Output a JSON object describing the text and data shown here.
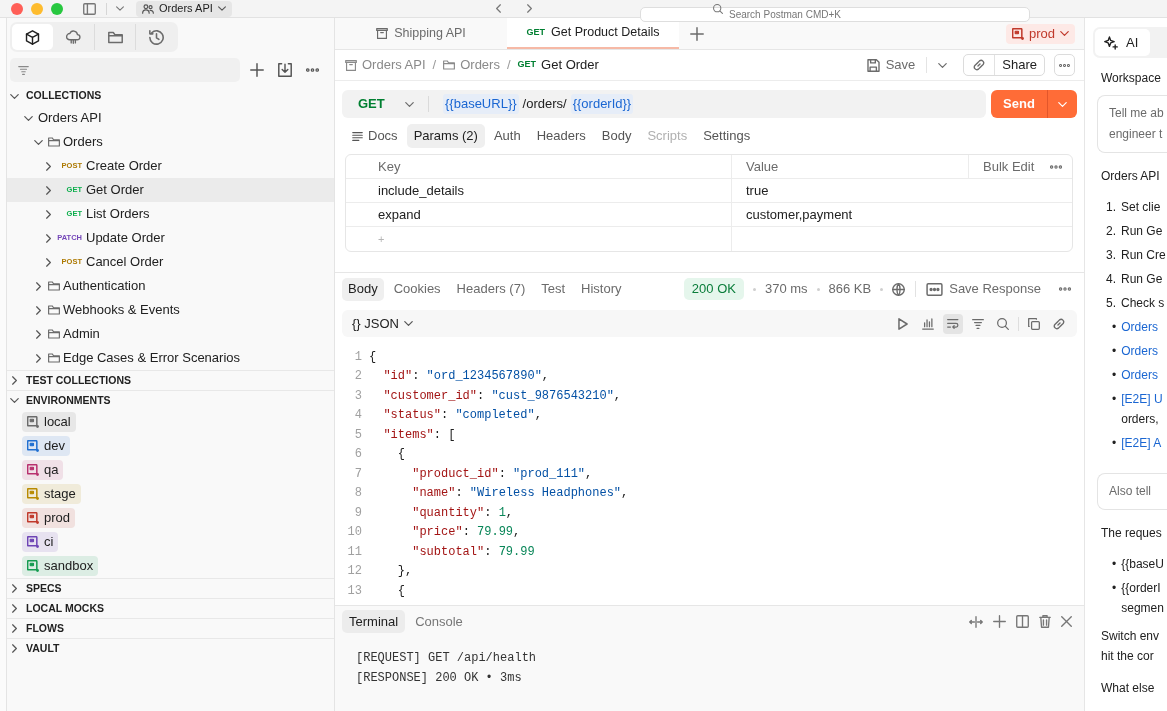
{
  "top_bar": {
    "workspace": "Orders API",
    "search": {
      "placeholder": "Search Postman CMD+K"
    }
  },
  "sidebar": {
    "tabs": [
      {
        "kind": "cube",
        "selected": true
      },
      {
        "kind": "cloud",
        "selected": false
      },
      {
        "kind": "folder",
        "selected": false
      },
      {
        "kind": "history",
        "selected": false
      }
    ],
    "sections": [
      {
        "title": "COLLECTIONS",
        "expanded": true,
        "tree": [
          {
            "kind": "collection",
            "name": "Orders API",
            "expanded": true,
            "selected": false,
            "children": [
              {
                "kind": "folder",
                "name": "Orders",
                "expanded": true,
                "selected": false,
                "children": [
                  {
                    "kind": "request",
                    "method": "POST",
                    "color": "#ad7a03",
                    "name": "Create Order",
                    "expanded": false,
                    "selected": false
                  },
                  {
                    "kind": "request",
                    "method": "GET",
                    "color": "#0cae4c",
                    "name": "Get Order",
                    "expanded": false,
                    "selected": true
                  },
                  {
                    "kind": "request",
                    "method": "GET",
                    "color": "#0cae4c",
                    "name": "List Orders",
                    "expanded": false,
                    "selected": false
                  },
                  {
                    "kind": "request",
                    "method": "PATCH",
                    "color": "#7446b8",
                    "name": "Update Order",
                    "expanded": false,
                    "selected": false
                  },
                  {
                    "kind": "request",
                    "method": "POST",
                    "color": "#ad7a03",
                    "name": "Cancel Order",
                    "expanded": false,
                    "selected": false
                  }
                ]
              },
              {
                "kind": "folder",
                "name": "Authentication",
                "expanded": false,
                "selected": false
              },
              {
                "kind": "folder",
                "name": "Webhooks & Events",
                "expanded": false,
                "selected": false
              },
              {
                "kind": "folder",
                "name": "Admin",
                "expanded": false,
                "selected": false
              },
              {
                "kind": "folder",
                "name": "Edge Cases & Error Scenarios",
                "expanded": false,
                "selected": false
              }
            ]
          }
        ]
      },
      {
        "title": "TEST COLLECTIONS",
        "expanded": false
      },
      {
        "title": "ENVIRONMENTS",
        "expanded": true,
        "environments": [
          {
            "name": "local",
            "color": "#6b6b6b"
          },
          {
            "name": "dev",
            "color": "#1f6fd1"
          },
          {
            "name": "qa",
            "color": "#b8306e"
          },
          {
            "name": "stage",
            "color": "#b88a00"
          },
          {
            "name": "prod",
            "color": "#c0392b"
          },
          {
            "name": "ci",
            "color": "#6e44b5"
          },
          {
            "name": "sandbox",
            "color": "#139b4f"
          }
        ]
      },
      {
        "title": "SPECS",
        "expanded": false
      },
      {
        "title": "LOCAL MOCKS",
        "expanded": false
      },
      {
        "title": "FLOWS",
        "expanded": false
      },
      {
        "title": "VAULT",
        "expanded": false
      }
    ]
  },
  "main": {
    "tabs": [
      {
        "kind": "collection",
        "label": "Shipping API",
        "selected": false
      },
      {
        "kind": "request",
        "method": "GET",
        "label": "Get Product Details",
        "selected": true
      }
    ],
    "environment": {
      "name": "prod"
    },
    "breadcrumb": [
      {
        "kind": "collection",
        "label": "Orders API"
      },
      {
        "kind": "separator",
        "label": "/"
      },
      {
        "kind": "folder",
        "label": "Orders"
      },
      {
        "kind": "separator",
        "label": "/"
      },
      {
        "kind": "request",
        "method": "GET",
        "label": "Get Order"
      }
    ],
    "save": "Save",
    "share": "Share",
    "request": {
      "method": "GET",
      "url": [
        {
          "kind": "variable",
          "text": "{{baseURL}}"
        },
        {
          "kind": "path",
          "text": "/orders/"
        },
        {
          "kind": "variable",
          "text": "{{orderId}}"
        }
      ],
      "send": "Send"
    },
    "request_tabs": [
      {
        "kind": "docs",
        "label": "Docs",
        "selected": false,
        "disabled": false
      },
      {
        "kind": "tab",
        "label": "Params (2)",
        "selected": true,
        "disabled": false
      },
      {
        "kind": "tab",
        "label": "Auth",
        "selected": false,
        "disabled": false
      },
      {
        "kind": "tab",
        "label": "Headers",
        "selected": false,
        "disabled": false
      },
      {
        "kind": "tab",
        "label": "Body",
        "selected": false,
        "disabled": false
      },
      {
        "kind": "tab",
        "label": "Scripts",
        "selected": false,
        "disabled": true
      },
      {
        "kind": "tab",
        "label": "Settings",
        "selected": false,
        "disabled": false
      }
    ],
    "params": {
      "columns": [
        "Key",
        "Value"
      ],
      "bulk_edit": "Bulk Edit",
      "rows": [
        {
          "key": "include_details",
          "value": "true"
        },
        {
          "key": "expand",
          "value": "customer,payment"
        }
      ],
      "new_row": {
        "placeholder": "+"
      }
    },
    "response": {
      "tabs": [
        {
          "label": "Body",
          "selected": true
        },
        {
          "label": "Cookies",
          "selected": false
        },
        {
          "label": "Headers (7)",
          "selected": false
        },
        {
          "label": "Test",
          "selected": false
        },
        {
          "label": "History",
          "selected": false
        }
      ],
      "status": "200 OK",
      "time": "370 ms",
      "size": "866 KB",
      "save_response": "Save Response",
      "format": {
        "glyph": "{}",
        "label": "JSON"
      },
      "tools": [
        {
          "kind": "play",
          "selected": false
        },
        {
          "kind": "chart",
          "selected": false
        },
        {
          "kind": "wrap",
          "selected": true
        },
        {
          "kind": "filter",
          "selected": false
        },
        {
          "kind": "search",
          "selected": false
        },
        {
          "kind": "copy",
          "selected": false
        },
        {
          "kind": "link",
          "selected": false
        }
      ],
      "lines": [
        {
          "number": "1",
          "tokens": [
            {
              "kind": "punct",
              "text": "{"
            }
          ]
        },
        {
          "number": "2",
          "tokens": [
            {
              "kind": "key",
              "text": "  \"id\""
            },
            {
              "kind": "punct",
              "text": ": "
            },
            {
              "kind": "string",
              "text": "\"ord_1234567890\""
            },
            {
              "kind": "punct",
              "text": ","
            }
          ]
        },
        {
          "number": "3",
          "tokens": [
            {
              "kind": "key",
              "text": "  \"customer_id\""
            },
            {
              "kind": "punct",
              "text": ": "
            },
            {
              "kind": "string",
              "text": "\"cust_9876543210\""
            },
            {
              "kind": "punct",
              "text": ","
            }
          ]
        },
        {
          "number": "4",
          "tokens": [
            {
              "kind": "key",
              "text": "  \"status\""
            },
            {
              "kind": "punct",
              "text": ": "
            },
            {
              "kind": "string",
              "text": "\"completed\""
            },
            {
              "kind": "punct",
              "text": ","
            }
          ]
        },
        {
          "number": "5",
          "tokens": [
            {
              "kind": "key",
              "text": "  \"items\""
            },
            {
              "kind": "punct",
              "text": ": ["
            }
          ]
        },
        {
          "number": "6",
          "tokens": [
            {
              "kind": "punct",
              "text": "    {"
            }
          ]
        },
        {
          "number": "7",
          "tokens": [
            {
              "kind": "key",
              "text": "      \"product_id\""
            },
            {
              "kind": "punct",
              "text": ": "
            },
            {
              "kind": "string",
              "text": "\"prod_111\""
            },
            {
              "kind": "punct",
              "text": ","
            }
          ]
        },
        {
          "number": "8",
          "tokens": [
            {
              "kind": "key",
              "text": "      \"name\""
            },
            {
              "kind": "punct",
              "text": ": "
            },
            {
              "kind": "string",
              "text": "\"Wireless Headphones\""
            },
            {
              "kind": "punct",
              "text": ","
            }
          ]
        },
        {
          "number": "9",
          "tokens": [
            {
              "kind": "key",
              "text": "      \"quantity\""
            },
            {
              "kind": "punct",
              "text": ": "
            },
            {
              "kind": "number",
              "text": "1"
            },
            {
              "kind": "punct",
              "text": ","
            }
          ]
        },
        {
          "number": "10",
          "tokens": [
            {
              "kind": "key",
              "text": "      \"price\""
            },
            {
              "kind": "punct",
              "text": ": "
            },
            {
              "kind": "number",
              "text": "79.99"
            },
            {
              "kind": "punct",
              "text": ","
            }
          ]
        },
        {
          "number": "11",
          "tokens": [
            {
              "kind": "key",
              "text": "      \"subtotal\""
            },
            {
              "kind": "punct",
              "text": ": "
            },
            {
              "kind": "number",
              "text": "79.99"
            }
          ]
        },
        {
          "number": "12",
          "tokens": [
            {
              "kind": "punct",
              "text": "    },"
            }
          ]
        },
        {
          "number": "13",
          "tokens": [
            {
              "kind": "punct",
              "text": "    {"
            }
          ]
        }
      ]
    },
    "terminal": {
      "tabs": [
        {
          "label": "Terminal",
          "selected": true
        },
        {
          "label": "Console",
          "selected": false
        }
      ],
      "lines": [
        "[REQUEST] GET /api/health",
        "[RESPONSE] 200 OK • 3ms"
      ]
    }
  },
  "ai_panel": {
    "tabs": [
      {
        "label": "AI",
        "selected": true
      }
    ],
    "blocks": [
      {
        "kind": "heading",
        "lines": [
          "Workspace"
        ]
      },
      {
        "kind": "prompt",
        "lines": [
          "Tell me ab",
          "engineer t"
        ]
      },
      {
        "kind": "paragraph",
        "lines": [
          "Orders API"
        ]
      },
      {
        "kind": "list",
        "items": [
          {
            "marker": "1.",
            "lines": [
              "Set clie"
            ]
          },
          {
            "marker": "2.",
            "lines": [
              "Run Ge"
            ]
          },
          {
            "marker": "3.",
            "lines": [
              "Run Cre"
            ]
          },
          {
            "marker": "4.",
            "lines": [
              "Run Ge"
            ]
          },
          {
            "marker": "5.",
            "lines": [
              "Check s"
            ]
          }
        ]
      },
      {
        "kind": "list",
        "items": [
          {
            "marker": "•",
            "link": "Orders"
          },
          {
            "marker": "•",
            "link": "Orders"
          },
          {
            "marker": "•",
            "link": "Orders"
          },
          {
            "marker": "•",
            "link": "[E2E] U",
            "lines": [
              "orders,"
            ]
          },
          {
            "marker": "•",
            "link": "[E2E] A"
          }
        ]
      },
      {
        "kind": "prompt",
        "lines": [
          "Also tell"
        ]
      },
      {
        "kind": "paragraph",
        "lines": [
          "The reques"
        ]
      },
      {
        "kind": "list",
        "items": [
          {
            "marker": "•",
            "lines": [
              "{{baseU"
            ]
          },
          {
            "marker": "•",
            "lines": [
              "{{orderI",
              "segmen"
            ]
          }
        ]
      },
      {
        "kind": "paragraph",
        "lines": [
          "Switch env",
          "hit the cor"
        ]
      },
      {
        "kind": "paragraph",
        "lines": [
          "What else"
        ]
      }
    ]
  }
}
